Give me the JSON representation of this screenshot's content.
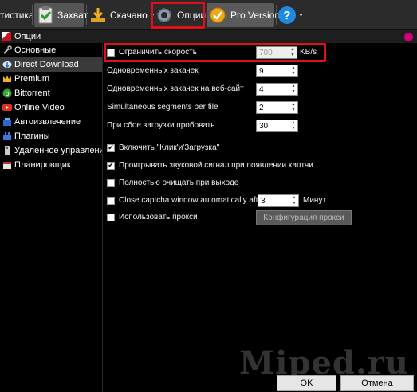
{
  "toolbar": {
    "stats_label": "тистика",
    "capture_label": "Захват",
    "downloaded_label": "Скачано",
    "options_label": "Опции",
    "pro_label": "Pro Version",
    "help_label": "?"
  },
  "window": {
    "title": "Опции"
  },
  "sidebar": {
    "items": [
      {
        "label": "Основные",
        "icon": "tools-icon"
      },
      {
        "label": "Direct Download",
        "icon": "cloud-download-icon"
      },
      {
        "label": "Premium",
        "icon": "crown-icon"
      },
      {
        "label": "Bittorrent",
        "icon": "bittorrent-icon"
      },
      {
        "label": "Online Video",
        "icon": "video-icon"
      },
      {
        "label": "Автоизвлечение",
        "icon": "extract-icon"
      },
      {
        "label": "Плагины",
        "icon": "plugin-icon"
      },
      {
        "label": "Удаленное управление",
        "icon": "remote-icon"
      },
      {
        "label": "Планировщик",
        "icon": "calendar-icon"
      }
    ],
    "active": "Direct Download"
  },
  "settings": {
    "limit_speed": {
      "label": "Ограничить скорость",
      "checked": false,
      "value": "700",
      "unit": "KB/s"
    },
    "max_downloads": {
      "label": "Одновременных закачек",
      "value": "9"
    },
    "max_per_site": {
      "label": "Одновременных закачек на веб-сайт",
      "value": "4"
    },
    "segments": {
      "label": "Simultaneous segments per file",
      "value": "2"
    },
    "retry": {
      "label": "При сбое загрузки пробовать",
      "value": "30"
    },
    "click_load": {
      "label": "Включить \"Клик'и'Загрузка\"",
      "checked": true
    },
    "sound_captcha": {
      "label": "Проигрывать звуковой сигнал при появлении каптчи",
      "checked": true
    },
    "clear_on_exit": {
      "label": "Полностью очищать при выходе",
      "checked": false
    },
    "close_captcha": {
      "label": "Close captcha window automatically after:",
      "checked": false,
      "value": "3",
      "unit": "Минут"
    },
    "use_proxy": {
      "label": "Использовать прокси",
      "checked": false
    },
    "proxy_button": "Конфигурация прокси"
  },
  "buttons": {
    "ok": "OK",
    "cancel": "Отмена"
  },
  "watermark": "Miped.ru",
  "colors": {
    "highlight": "#e0101a",
    "accent_dot": "#d4007a",
    "help_blue": "#1e88e5"
  }
}
